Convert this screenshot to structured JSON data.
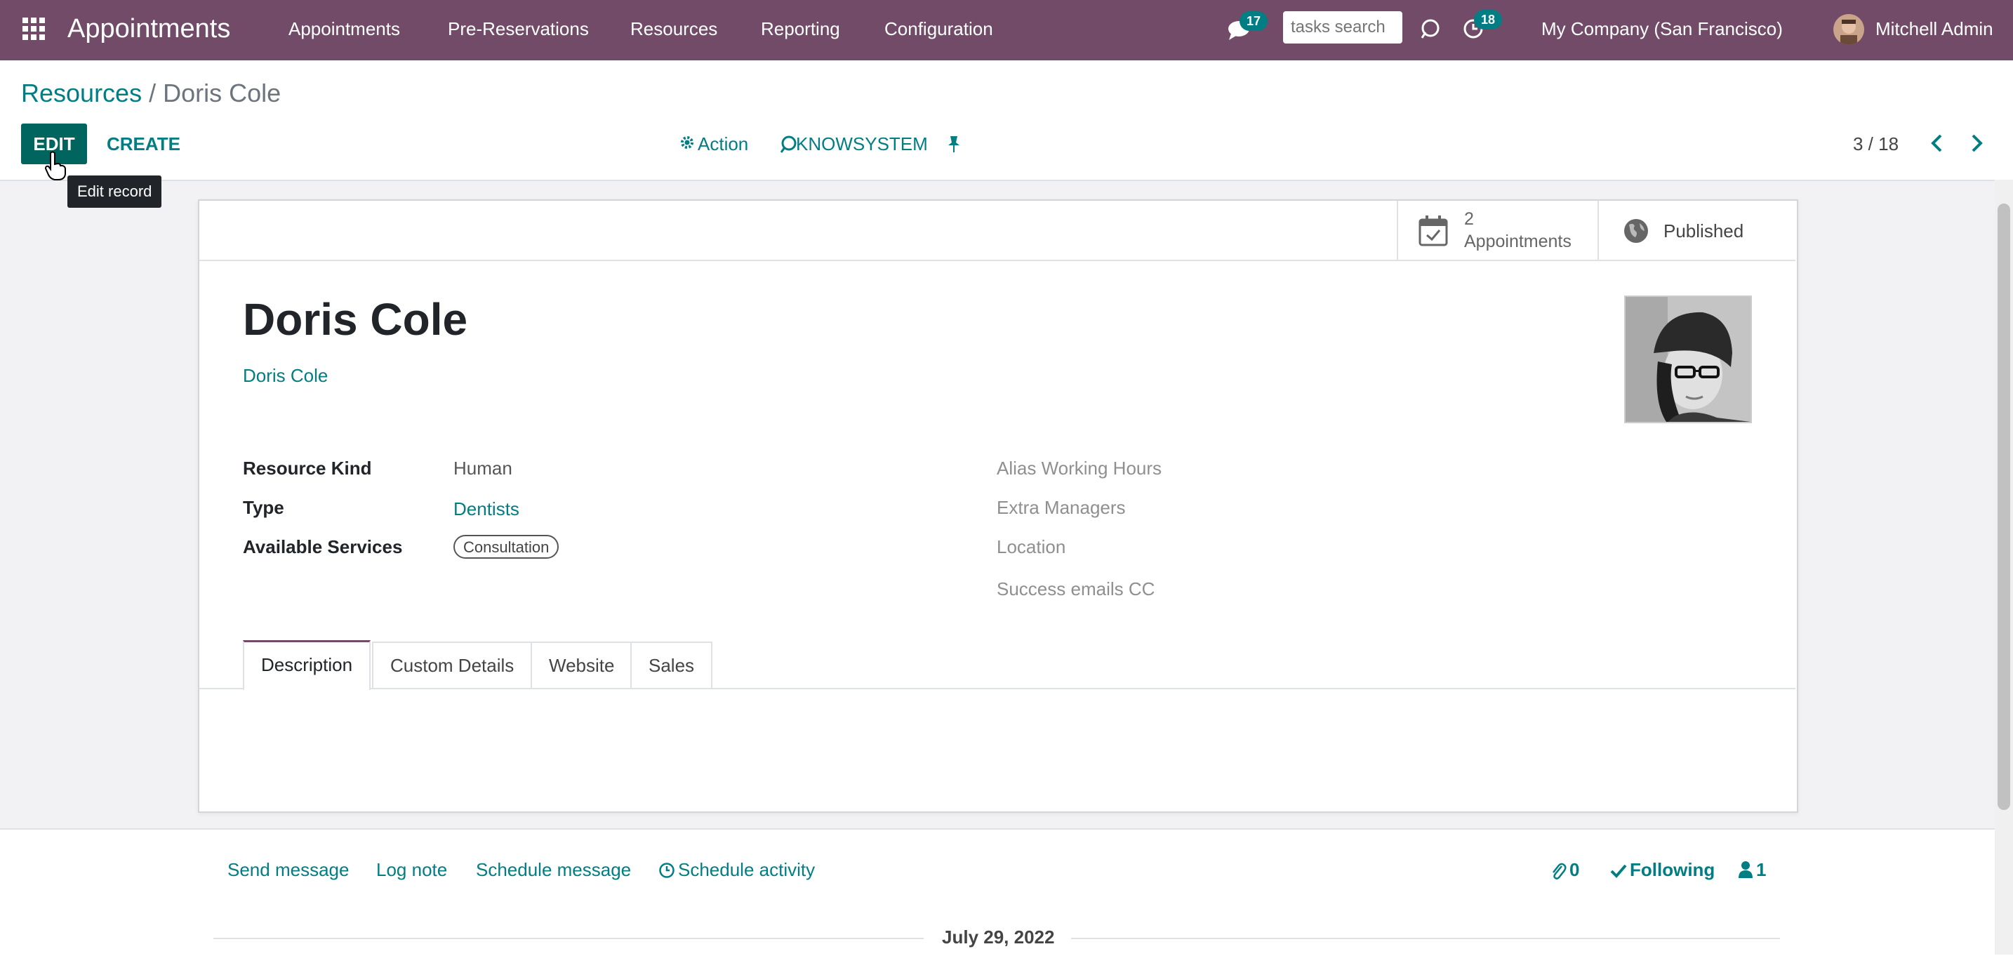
{
  "navbar": {
    "app_title": "Appointments",
    "menu": [
      "Appointments",
      "Pre-Reservations",
      "Resources",
      "Reporting",
      "Configuration"
    ],
    "messages_count": "17",
    "search_placeholder": "tasks search",
    "activities_count": "18",
    "company": "My Company (San Francisco)",
    "user": "Mitchell Admin"
  },
  "breadcrumb": {
    "parent": "Resources",
    "separator": "/",
    "current": "Doris Cole"
  },
  "toolbar": {
    "edit_label": "EDIT",
    "create_label": "CREATE",
    "tooltip": "Edit record",
    "action_label": "Action",
    "knowsystem_label": "KNOWSYSTEM",
    "pager": "3 / 18"
  },
  "smart_buttons": {
    "appointments_count": "2",
    "appointments_label": "Appointments",
    "published_label": "Published"
  },
  "record": {
    "name": "Doris Cole",
    "related_user": "Doris Cole",
    "fields_left": [
      {
        "label": "Resource Kind",
        "value": "Human"
      },
      {
        "label": "Type",
        "value": "Dentists"
      },
      {
        "label": "Available Services",
        "value": "Consultation"
      }
    ],
    "fields_right": [
      "Alias Working Hours",
      "Extra Managers",
      "Location",
      "Success emails CC"
    ]
  },
  "tabs": [
    "Description",
    "Custom Details",
    "Website",
    "Sales"
  ],
  "chatter": {
    "send_message": "Send message",
    "log_note": "Log note",
    "schedule_message": "Schedule message",
    "schedule_activity": "Schedule activity",
    "attachments_count": "0",
    "following_label": "Following",
    "followers_count": "1",
    "date_separator": "July 29, 2022"
  },
  "colors": {
    "brand": "#714b67",
    "accent": "#017e84"
  }
}
